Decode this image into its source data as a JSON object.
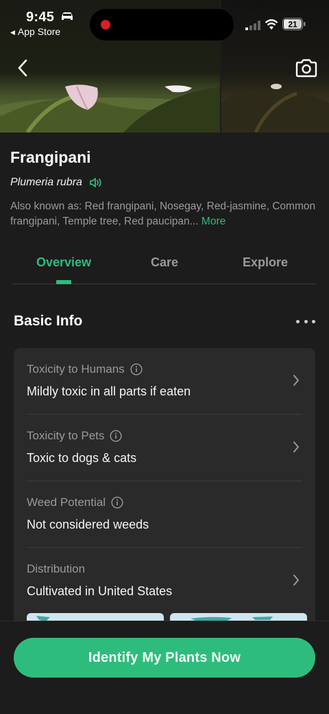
{
  "status_bar": {
    "time": "9:45",
    "back_app": "App Store",
    "battery": "21"
  },
  "plant": {
    "name": "Frangipani",
    "scientific_name": "Plumeria rubra",
    "also_known_as": "Also known as: Red frangipani, Nosegay, Red-jasmine, Common frangipani, Temple tree, Red paucipan...",
    "more_label": "More"
  },
  "tabs": [
    {
      "label": "Overview",
      "active": true
    },
    {
      "label": "Care",
      "active": false
    },
    {
      "label": "Explore",
      "active": false
    }
  ],
  "basic_info": {
    "title": "Basic Info",
    "rows": [
      {
        "label": "Toxicity to Humans",
        "value": "Mildly toxic in all parts if eaten",
        "has_info_icon": true,
        "has_chevron": true
      },
      {
        "label": "Toxicity to Pets",
        "value": "Toxic to dogs & cats",
        "has_info_icon": true,
        "has_chevron": true
      },
      {
        "label": "Weed Potential",
        "value": "Not considered weeds",
        "has_info_icon": true,
        "has_chevron": false
      },
      {
        "label": "Distribution",
        "value": "Cultivated in United States",
        "has_info_icon": false,
        "has_chevron": true
      }
    ]
  },
  "cta": {
    "label": "Identify My Plants Now"
  },
  "colors": {
    "accent": "#2ebc7c",
    "background": "#1c1c1c",
    "card": "#2a2a2a",
    "muted_text": "#9a9a9a"
  },
  "icons": [
    "car-icon",
    "signal-icon",
    "wifi-icon",
    "battery-icon",
    "back-chevron-icon",
    "camera-icon",
    "speaker-icon",
    "info-icon",
    "chevron-right-icon",
    "more-dots-icon"
  ]
}
